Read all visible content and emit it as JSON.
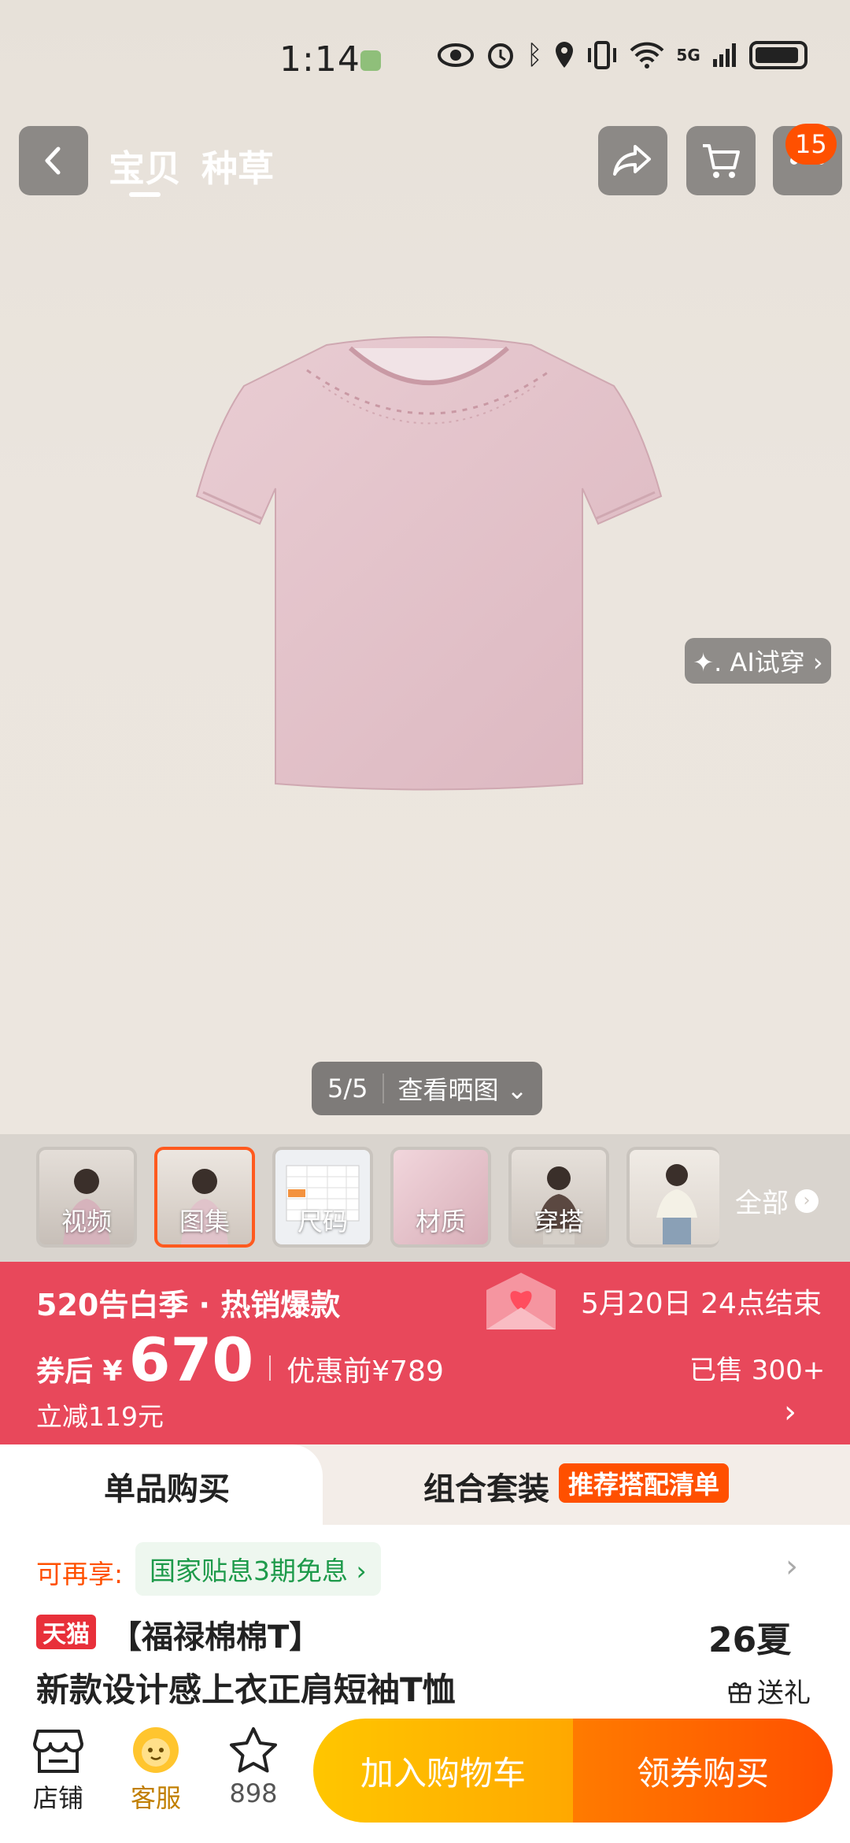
{
  "status": {
    "time": "1:14",
    "network": "5G"
  },
  "nav": {
    "tabs": [
      "宝贝",
      "种草"
    ],
    "cart_badge": "15",
    "icons": [
      "back-arrow-icon",
      "share-icon",
      "cart-icon",
      "more-icon"
    ]
  },
  "gallery": {
    "ai_tryon": "✦. AI试穿 ›",
    "counter": "5/5",
    "view_photos": "查看晒图 ⌄",
    "thumbs": [
      "视频",
      "图集",
      "尺码",
      "材质",
      "穿搭"
    ],
    "all_label": "全部"
  },
  "promo": {
    "event": "520告白季 · 热销爆款",
    "ends": "5月20日 24点结束",
    "price_prefix": "券后 ¥",
    "price": "670",
    "original": "优惠前¥789",
    "sold": "已售 300+",
    "reduced": "立减119元",
    "bg_color": "#e8485b"
  },
  "buy_tabs": {
    "single": "单品购买",
    "combo": "组合套装",
    "combo_tag": "推荐搭配清单"
  },
  "info": {
    "more_label": "可再享:",
    "subsidy": "国家贴息3期免息 ›",
    "store_tag": "天猫",
    "title_line1": "【福禄棉棉T】",
    "title_line2": "新款设计感上衣正肩短袖T恤",
    "season": "26夏",
    "gift": "送礼"
  },
  "bottom": {
    "store": "店铺",
    "service": "客服",
    "favorites": "898",
    "add_cart": "加入购物车",
    "buy_coupon": "领券购买"
  }
}
